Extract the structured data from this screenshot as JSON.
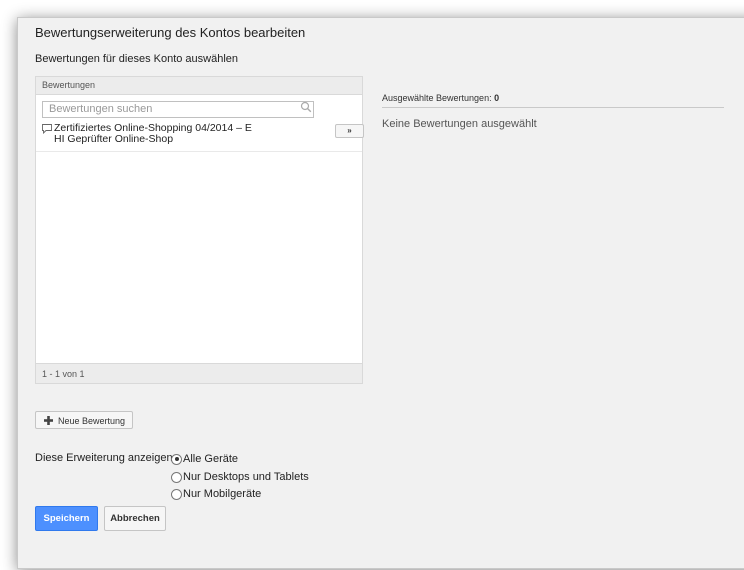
{
  "dialog": {
    "title": "Bewertungserweiterung des Kontos bearbeiten",
    "subtitle": "Bewertungen für dieses Konto auswählen"
  },
  "ratings_panel": {
    "header": "Bewertungen",
    "search_placeholder": "Bewertungen suchen",
    "items": [
      {
        "line1": "Zertifiziertes Online-Shopping 04/2014 – E",
        "line2": "HI Geprüfter Online-Shop",
        "add_label": "»",
        "icon": "comment-icon"
      }
    ],
    "pagination": "1 - 1 von 1"
  },
  "selected_panel": {
    "label": "Ausgewählte Bewertungen:",
    "count": "0",
    "empty_text": "Keine Bewertungen ausgewählt"
  },
  "new_rating_button": {
    "label": "Neue Bewertung",
    "icon": "plus-icon"
  },
  "devices": {
    "label": "Diese Erweiterung anzeigen",
    "options": [
      {
        "label": "Alle Geräte",
        "checked": true
      },
      {
        "label": "Nur Desktops und Tablets",
        "checked": false
      },
      {
        "label": "Nur Mobilgeräte",
        "checked": false
      }
    ]
  },
  "actions": {
    "save_label": "Speichern",
    "cancel_label": "Abbrechen"
  },
  "colors": {
    "primary_button": "#4d90fe",
    "dialog_background": "#f1f1f1"
  }
}
